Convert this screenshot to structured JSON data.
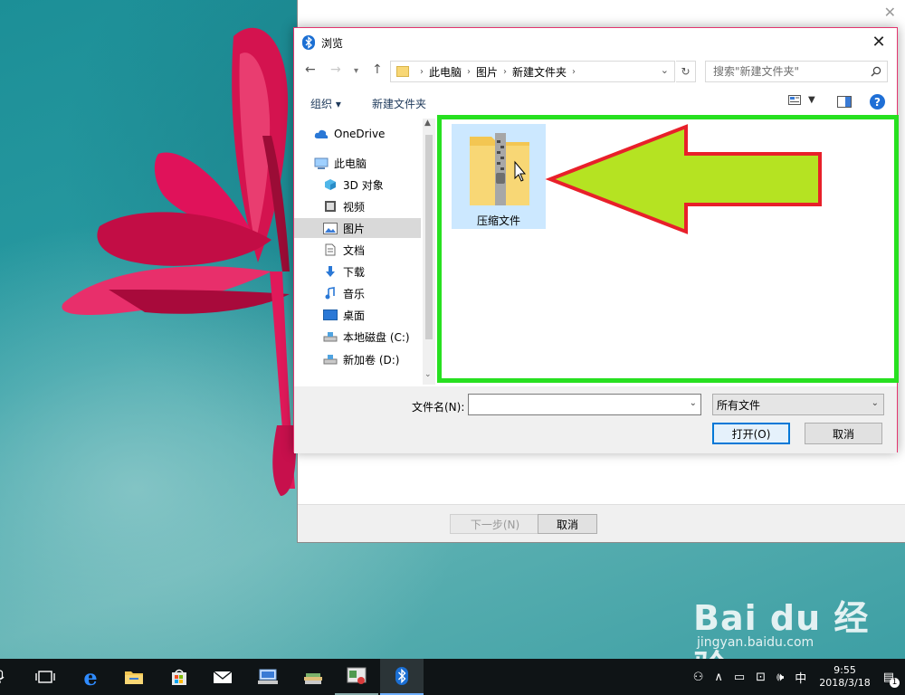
{
  "wizard": {
    "next_label": "下一步(N)",
    "cancel_label": "取消"
  },
  "dialog": {
    "title": "浏览",
    "breadcrumb": [
      "此电脑",
      "图片",
      "新建文件夹"
    ],
    "search_placeholder": "搜索\"新建文件夹\"",
    "toolbar": {
      "organize_label": "组织 ▾",
      "new_folder_label": "新建文件夹"
    },
    "nav_items": [
      {
        "label": "OneDrive",
        "icon": "cloud-icon"
      },
      {
        "label": "此电脑",
        "icon": "computer-icon"
      },
      {
        "label": "3D 对象",
        "icon": "cube-icon"
      },
      {
        "label": "视频",
        "icon": "video-icon"
      },
      {
        "label": "图片",
        "icon": "picture-icon",
        "selected": true
      },
      {
        "label": "文档",
        "icon": "document-icon"
      },
      {
        "label": "下载",
        "icon": "download-icon"
      },
      {
        "label": "音乐",
        "icon": "music-icon"
      },
      {
        "label": "桌面",
        "icon": "desktop-icon"
      },
      {
        "label": "本地磁盘 (C:)",
        "icon": "drive-icon"
      },
      {
        "label": "新加卷 (D:)",
        "icon": "drive-icon"
      }
    ],
    "files": [
      {
        "label": "压缩文件",
        "icon": "zip-folder-icon"
      }
    ],
    "filename_label": "文件名(N):",
    "filename_value": "",
    "filetype_value": "所有文件",
    "open_label": "打开(O)",
    "cancel_label": "取消"
  },
  "taskbar": {
    "time": "9:55",
    "date": "2018/3/18",
    "ime": "中",
    "notification_count": "1"
  },
  "watermark": {
    "brand": "Bai du 经验",
    "url": "jingyan.baidu.com"
  },
  "colors": {
    "highlight_frame": "#27e020",
    "arrow_fill": "#b5e322",
    "arrow_stroke": "#e8202a",
    "dialog_border": "#e3356f",
    "selection": "#cce8ff"
  }
}
